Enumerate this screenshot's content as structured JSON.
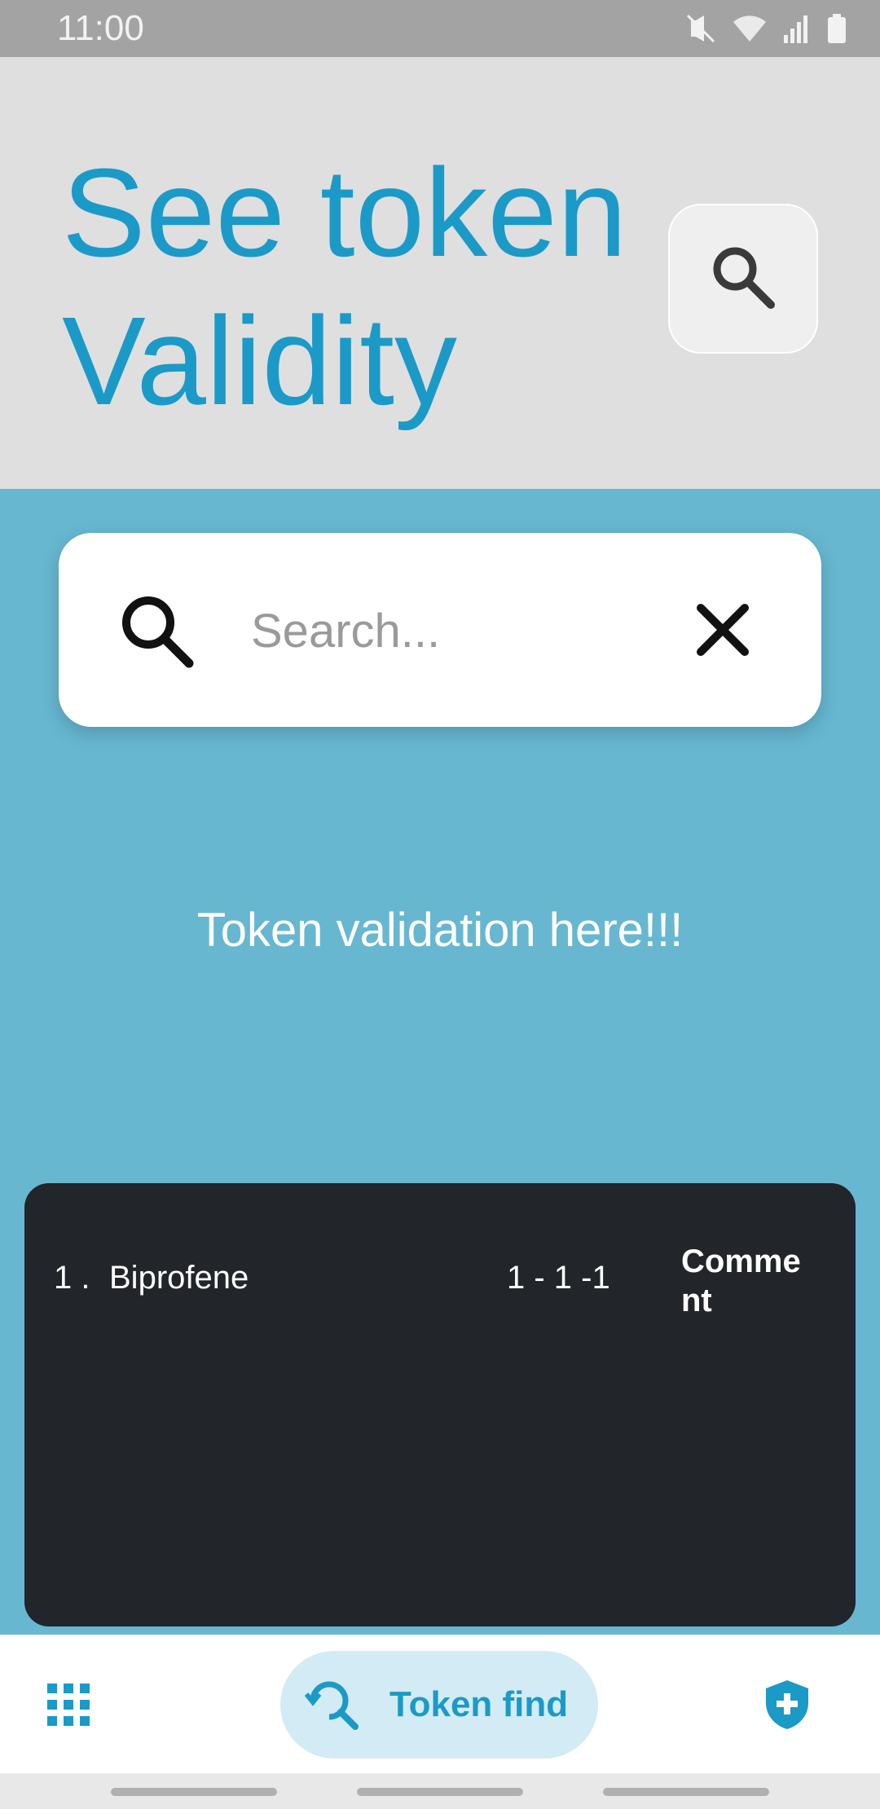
{
  "status_bar": {
    "time": "11:00",
    "icons": [
      "mute-icon",
      "wifi-icon",
      "signal-icon",
      "battery-icon"
    ]
  },
  "header": {
    "title": "See token Validity",
    "search_button_icon": "search-icon"
  },
  "search": {
    "placeholder": "Search...",
    "value": "",
    "clear_icon": "close-icon"
  },
  "validation_message": "Token validation here!!!",
  "results": [
    {
      "index": "1 .",
      "name": "Biprofene",
      "code": "1 - 1 -1",
      "comment": "Comment"
    }
  ],
  "bottom_nav": {
    "apps_icon": "grid-icon",
    "token_find_label": "Token find",
    "token_find_icon": "search-refresh-icon",
    "shield_icon": "shield-plus-icon"
  },
  "colors": {
    "accent": "#1b9ac8",
    "background": "#67b7d1",
    "header_bg": "#dfdfdf",
    "panel_bg": "#22252a"
  }
}
